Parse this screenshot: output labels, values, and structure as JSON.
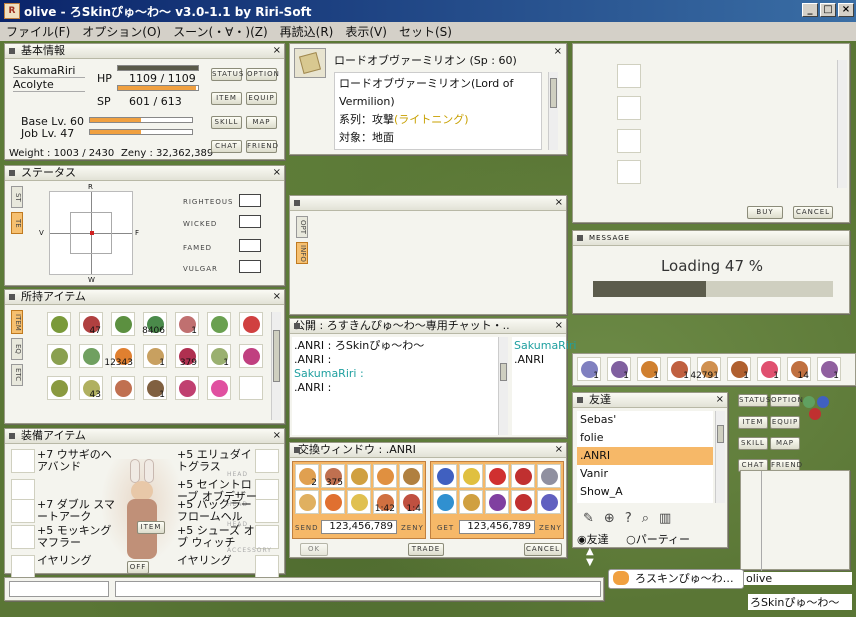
{
  "window": {
    "title": "olive - ろSkinぴゅ～わ～ v3.0-1.1 by Riri-Soft",
    "icon": "app-icon"
  },
  "menu": [
    "ファイル(F)",
    "オプション(O)",
    "スーン(・∀・)(Z)",
    "再読込(R)",
    "表示(V)",
    "セット(S)"
  ],
  "basic": {
    "title": "基本情報",
    "name": "SakumaRiri",
    "job": "Acolyte",
    "hp_label": "HP",
    "hp": "1109 / 1109",
    "hp_ratio": 1.0,
    "sp_label": "SP",
    "sp": "601 / 613",
    "sp_ratio": 0.98,
    "base_lv": "Base Lv. 60",
    "job_lv": "Job Lv. 47",
    "base_ratio": 0.5,
    "job_ratio": 0.5,
    "weight": "Weight : 1003 / 2430",
    "zeny": "Zeny : 32,362,389",
    "buttons": [
      "STATUS",
      "OPTION",
      "ITEM",
      "EQUIP",
      "SKILL",
      "MAP",
      "CHAT",
      "FRIEND"
    ]
  },
  "status": {
    "title": "ステータス",
    "tabs": [
      "ST",
      "TE"
    ],
    "axes": {
      "top": "R",
      "left": "V",
      "right": "F",
      "bottom": "W"
    },
    "labels": [
      "RIGHTEOUS",
      "WICKED",
      "FAMED",
      "VULGAR"
    ]
  },
  "inventory": {
    "title": "所持アイテム",
    "tabs": [
      "ITEM",
      "EQ",
      "ETC"
    ],
    "rows": [
      [
        {
          "c": "#7a9a3a",
          "q": ""
        },
        {
          "c": "#b04040",
          "q": "47"
        },
        {
          "c": "#5c9040",
          "q": ""
        },
        {
          "c": "#4a8a4a",
          "q": "8406"
        },
        {
          "c": "#c07070",
          "q": "1"
        },
        {
          "c": "#6aa050",
          "q": ""
        },
        {
          "c": "#d04040",
          "q": ""
        }
      ],
      [
        {
          "c": "#8aa050",
          "q": ""
        },
        {
          "c": "#70a060",
          "q": ""
        },
        {
          "c": "#e08030",
          "q": "12343"
        },
        {
          "c": "#c8a060",
          "q": "1"
        },
        {
          "c": "#b03050",
          "q": "379"
        },
        {
          "c": "#9ab070",
          "q": "1"
        },
        {
          "c": "#c04080",
          "q": ""
        }
      ],
      [
        {
          "c": "#8a9a40",
          "q": ""
        },
        {
          "c": "#b0b060",
          "q": "43"
        },
        {
          "c": "#c07050",
          "q": ""
        },
        {
          "c": "#806040",
          "q": "1"
        },
        {
          "c": "#c04070",
          "q": ""
        },
        {
          "c": "#e050a0",
          "q": ""
        },
        {
          "c": "#ffffff",
          "q": ""
        }
      ]
    ]
  },
  "equip": {
    "title": "装備アイテム",
    "left": [
      "+7 ウサギのヘアバンド",
      "",
      "+7 ダブル スマートアーク",
      "+5 モッキングマフラー",
      "イヤリング"
    ],
    "right": [
      "+5 エリュダイトグラス",
      "+5 セイントローブ オブデザー",
      "+5 バックラーフロームヘル",
      "+5 シューズ オブ ウィッチ",
      "イヤリング"
    ],
    "tags": [
      "HEAD",
      "HEAD",
      "HEAD",
      "ACCESSORY",
      "ACCESSORY"
    ],
    "item_btn": "ITEM",
    "off_btn": "OFF"
  },
  "skill": {
    "title": "ロードオブヴァーミリオン (Sp : 60)",
    "desc1": "ロードオブヴァーミリオン(Lord of Vermilion)",
    "kei": "系列：攻撃",
    "light": "(ライトニング)",
    "target": "対象：地面"
  },
  "mid": {
    "tabs": [
      "OPT",
      "INFO"
    ]
  },
  "chat": {
    "title": "公開 : ろすきんぴゅ～わ～専用チャット・..",
    "lines": [
      ".ANRI : ろSkinぴゅ～わ～",
      ".ANRI :",
      "SakumaRiri :",
      ".ANRI :"
    ],
    "names": [
      "SakumaRiri",
      ".ANRI"
    ]
  },
  "trade": {
    "title": "交換ウィンドウ : .ANRI",
    "send_label": "SEND",
    "get_label": "GET",
    "send_zeny": "123,456,789",
    "get_zeny": "123,456,789",
    "zeny_label": "ZENY",
    "ok": "OK",
    "trade": "TRADE",
    "cancel": "CANCEL",
    "send_items": [
      {
        "c": "#e0a050",
        "q": "2"
      },
      {
        "c": "#c07050",
        "q": "375"
      },
      {
        "c": "#d0a040",
        "q": ""
      },
      {
        "c": "#e09040",
        "q": ""
      },
      {
        "c": "#b08040",
        "q": ""
      },
      {
        "c": "#e0b060",
        "q": ""
      },
      {
        "c": "#e07030",
        "q": ""
      },
      {
        "c": "#e0c050",
        "q": ""
      },
      {
        "c": "#d07040",
        "q": "1:42"
      },
      {
        "c": "#c05040",
        "q": "1:4"
      }
    ],
    "get_items": [
      {
        "c": "#4060c0",
        "q": ""
      },
      {
        "c": "#e0c040",
        "q": ""
      },
      {
        "c": "#d03030",
        "q": ""
      },
      {
        "c": "#c03030",
        "q": ""
      },
      {
        "c": "#9090a0",
        "q": ""
      },
      {
        "c": "#3090d0",
        "q": ""
      },
      {
        "c": "#d0a040",
        "q": ""
      },
      {
        "c": "#8040a0",
        "q": ""
      },
      {
        "c": "#c03030",
        "q": ""
      },
      {
        "c": "#6060c0",
        "q": ""
      }
    ]
  },
  "shop": {
    "buy": "BUY",
    "cancel": "CANCEL"
  },
  "message": {
    "title": "MESSAGE",
    "text": "Loading 47 %",
    "progress": 0.47
  },
  "hotbar": [
    {
      "c": "#8080c0",
      "q": "1"
    },
    {
      "c": "#8060a0",
      "q": "1"
    },
    {
      "c": "#d08030",
      "q": "1"
    },
    {
      "c": "#c06040",
      "q": "1"
    },
    {
      "c": "#d09050",
      "q": "42791"
    },
    {
      "c": "#b06030",
      "q": "1"
    },
    {
      "c": "#e05070",
      "q": "1"
    },
    {
      "c": "#c07040",
      "q": "14"
    },
    {
      "c": "#9060a0",
      "q": "1"
    }
  ],
  "friends": {
    "title": "友達",
    "list": [
      "Sebas'",
      "folie",
      ".ANRI",
      "Vanir",
      "Show_A"
    ],
    "selected": 2,
    "mode_friend": "友達",
    "mode_party": "パーティー"
  },
  "mini": {
    "buttons": [
      "STATUS",
      "OPTION",
      "ITEM",
      "EQUIP",
      "SKILL",
      "MAP",
      "CHAT",
      "FRIEND"
    ],
    "name": "olive",
    "skin": "ろSkinぴゅ～わ～"
  },
  "chatbubble": {
    "text": "ろスキンぴゅ～わ…"
  },
  "colors": {
    "hp": "#5a5a4a",
    "sp": "#f0a040",
    "accent": "#f6b868",
    "progress": "#5c5c4c"
  }
}
